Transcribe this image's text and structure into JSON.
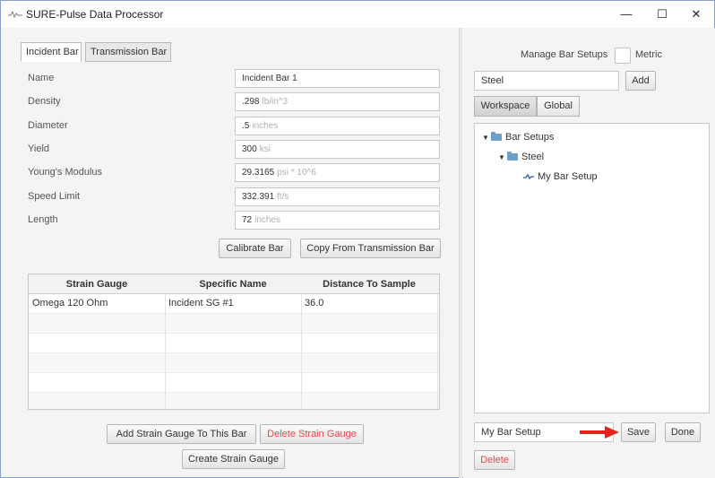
{
  "window": {
    "title": "SURE-Pulse Data Processor",
    "minimize": "—",
    "maximize": "☐",
    "close": "✕"
  },
  "tabs": [
    {
      "label": "Incident Bar",
      "active": true
    },
    {
      "label": "Transmission Bar",
      "active": false
    }
  ],
  "form": {
    "name": {
      "label": "Name",
      "value": "Incident Bar 1",
      "unit": ""
    },
    "density": {
      "label": "Density",
      "value": ".298",
      "unit": "lb/in^3"
    },
    "diameter": {
      "label": "Diameter",
      "value": ".5",
      "unit": "inches"
    },
    "yield": {
      "label": "Yield",
      "value": "300",
      "unit": "ksi"
    },
    "youngs": {
      "label": "Young's Modulus",
      "value": "29.3165",
      "unit": "psi * 10^6"
    },
    "speed": {
      "label": "Speed Limit",
      "value": "332.391",
      "unit": "ft/s"
    },
    "length": {
      "label": "Length",
      "value": "72",
      "unit": "inches"
    }
  },
  "buttons": {
    "calibrate": "Calibrate Bar",
    "copy": "Copy From Transmission Bar",
    "add_gauge": "Add Strain Gauge To This Bar",
    "delete_gauge": "Delete Strain Gauge",
    "create_gauge": "Create Strain Gauge"
  },
  "table": {
    "headers": [
      "Strain Gauge",
      "Specific Name",
      "Distance To Sample"
    ],
    "rows": [
      [
        "Omega 120 Ohm",
        "Incident SG #1",
        "36.0"
      ]
    ]
  },
  "right": {
    "manage_label": "Manage Bar Setups",
    "metric_label": "Metric",
    "metric_checked": false,
    "search_value": "Steel",
    "add_label": "Add",
    "seg_workspace": "Workspace",
    "seg_global": "Global",
    "tree": {
      "root": "Bar Setups",
      "folder": "Steel",
      "leaf": "My Bar Setup"
    },
    "setup_name_value": "My Bar Setup",
    "save_label": "Save",
    "done_label": "Done",
    "delete_label": "Delete"
  },
  "colors": {
    "accent_red": "#e8211a",
    "delete_text": "#e04a4a",
    "folder_blue": "#6f9ec9"
  }
}
